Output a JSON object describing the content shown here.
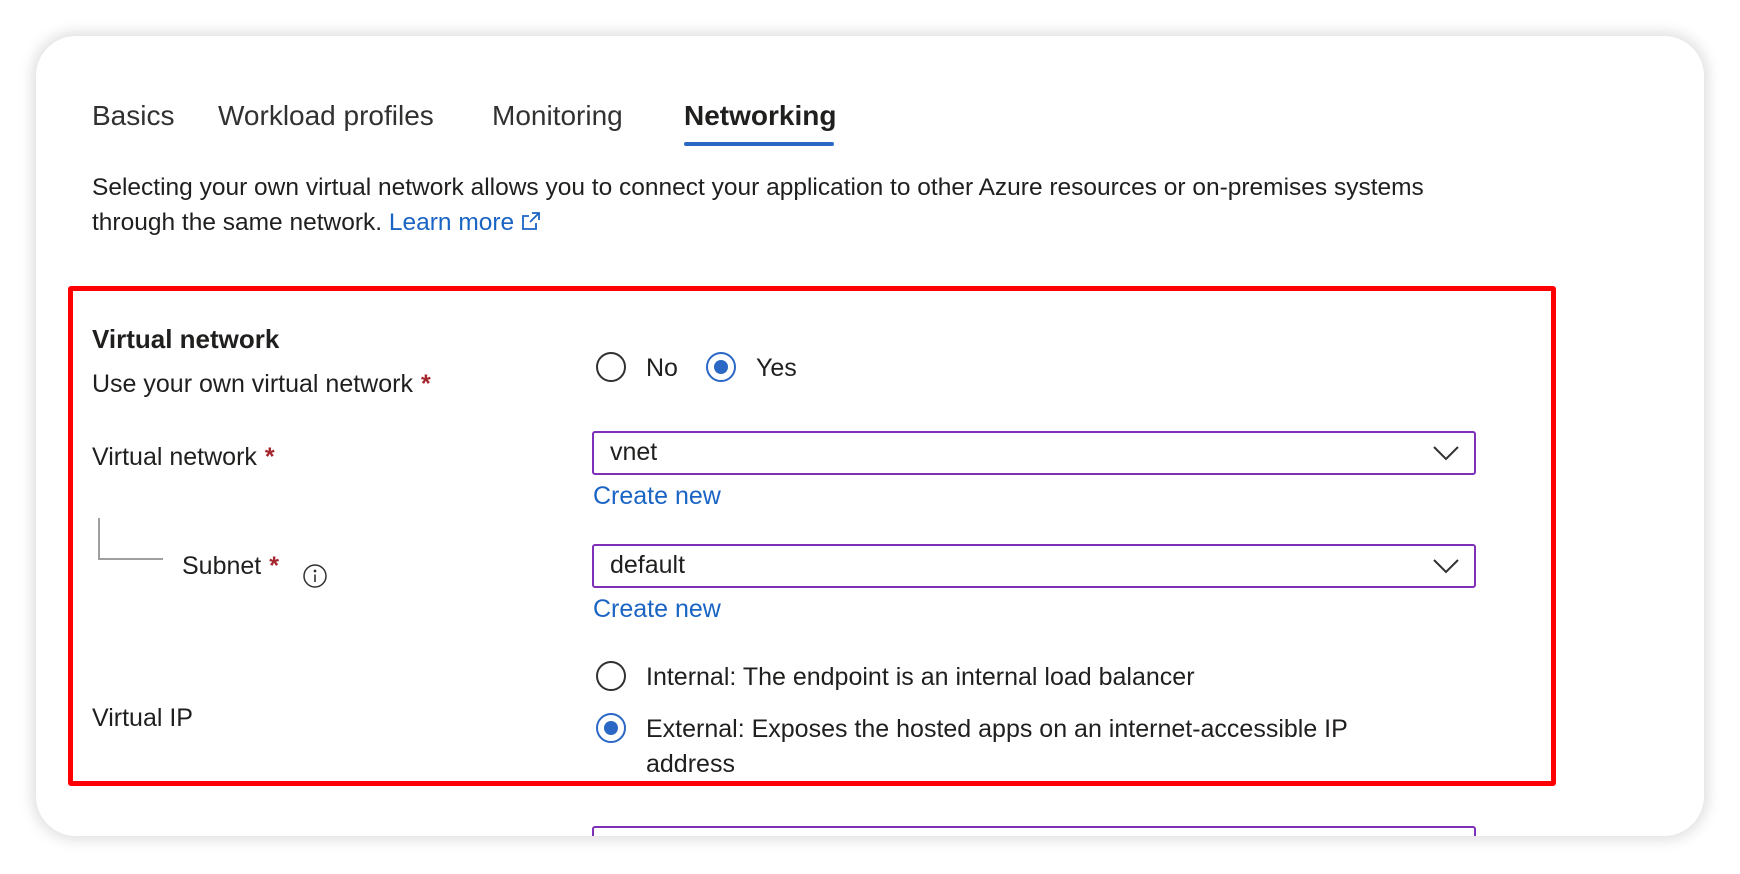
{
  "tabs": [
    {
      "label": "Basics",
      "active": false
    },
    {
      "label": "Workload profiles",
      "active": false
    },
    {
      "label": "Monitoring",
      "active": false
    },
    {
      "label": "Networking",
      "active": true
    }
  ],
  "intro": {
    "text": "Selecting your own virtual network allows you to connect your application to other Azure resources or on-premises systems through the same network.",
    "learn_more": "Learn more"
  },
  "section": {
    "title": "Virtual network"
  },
  "use_own_vnet": {
    "label": "Use your own virtual network",
    "required": "*",
    "options": [
      {
        "label": "No",
        "selected": false
      },
      {
        "label": "Yes",
        "selected": true
      }
    ]
  },
  "virtual_network": {
    "label": "Virtual network",
    "required": "*",
    "value": "vnet",
    "create_new": "Create new"
  },
  "subnet": {
    "label": "Subnet",
    "required": "*",
    "value": "default",
    "create_new": "Create new"
  },
  "virtual_ip": {
    "label": "Virtual IP",
    "options": [
      {
        "label": "Internal: The endpoint is an internal load balancer",
        "selected": false
      },
      {
        "label": "External: Exposes the hosted apps on an internet-accessible IP address",
        "selected": true
      }
    ]
  },
  "colors": {
    "accent": "#2b67c5",
    "link": "#1a64c4",
    "field_border": "#7f2fb8",
    "highlight": "#ff0000",
    "required": "#a4262c"
  }
}
